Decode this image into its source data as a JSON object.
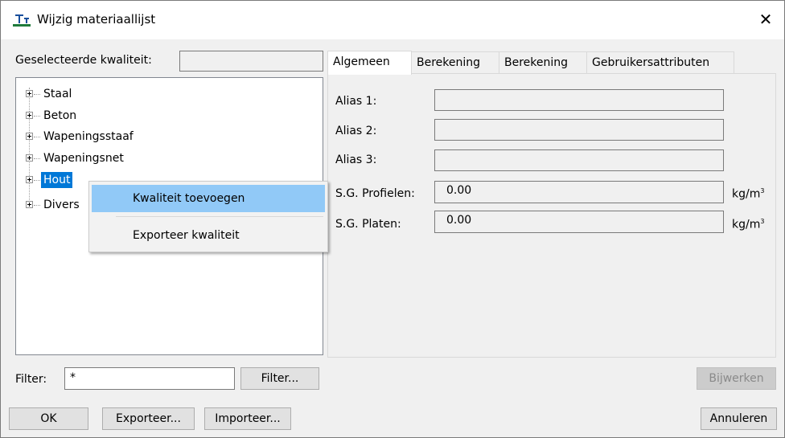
{
  "window": {
    "title": "Wijzig materiaallijst",
    "close_glyph": "✕"
  },
  "left": {
    "selected_label": "Geselecteerde kwaliteit:",
    "selected_value": "",
    "tree": [
      {
        "label": "Staal"
      },
      {
        "label": "Beton"
      },
      {
        "label": "Wapeningsstaaf"
      },
      {
        "label": "Wapeningsnet"
      },
      {
        "label": "Hout",
        "selected": true
      },
      {
        "label": "Divers"
      }
    ],
    "filter_label": "Filter:",
    "filter_value": "*",
    "filter_button": "Filter..."
  },
  "context_menu": {
    "items": [
      {
        "label": "Kwaliteit toevoegen",
        "highlighted": true
      },
      {
        "label": "Exporteer kwaliteit"
      }
    ]
  },
  "tabs": [
    {
      "label": "Algemeen",
      "active": true
    },
    {
      "label": "Berekening"
    },
    {
      "label": "Berekening"
    },
    {
      "label": "Gebruikersattributen"
    }
  ],
  "general": {
    "alias1_label": "Alias 1:",
    "alias1_value": "",
    "alias2_label": "Alias 2:",
    "alias2_value": "",
    "alias3_label": "Alias 3:",
    "alias3_value": "",
    "sg_profielen_label": "S.G. Profielen:",
    "sg_profielen_value": "0.00",
    "sg_platen_label": "S.G. Platen:",
    "sg_platen_value": "0.00",
    "unit": "kg/m",
    "unit_sup": "3"
  },
  "buttons": {
    "bijwerken": "Bijwerken",
    "ok": "OK",
    "exporteer": "Exporteer...",
    "importeer": "Importeer...",
    "annuleren": "Annuleren"
  },
  "colors": {
    "selection": "#0078d7",
    "menu_highlight": "#91c9f7"
  }
}
